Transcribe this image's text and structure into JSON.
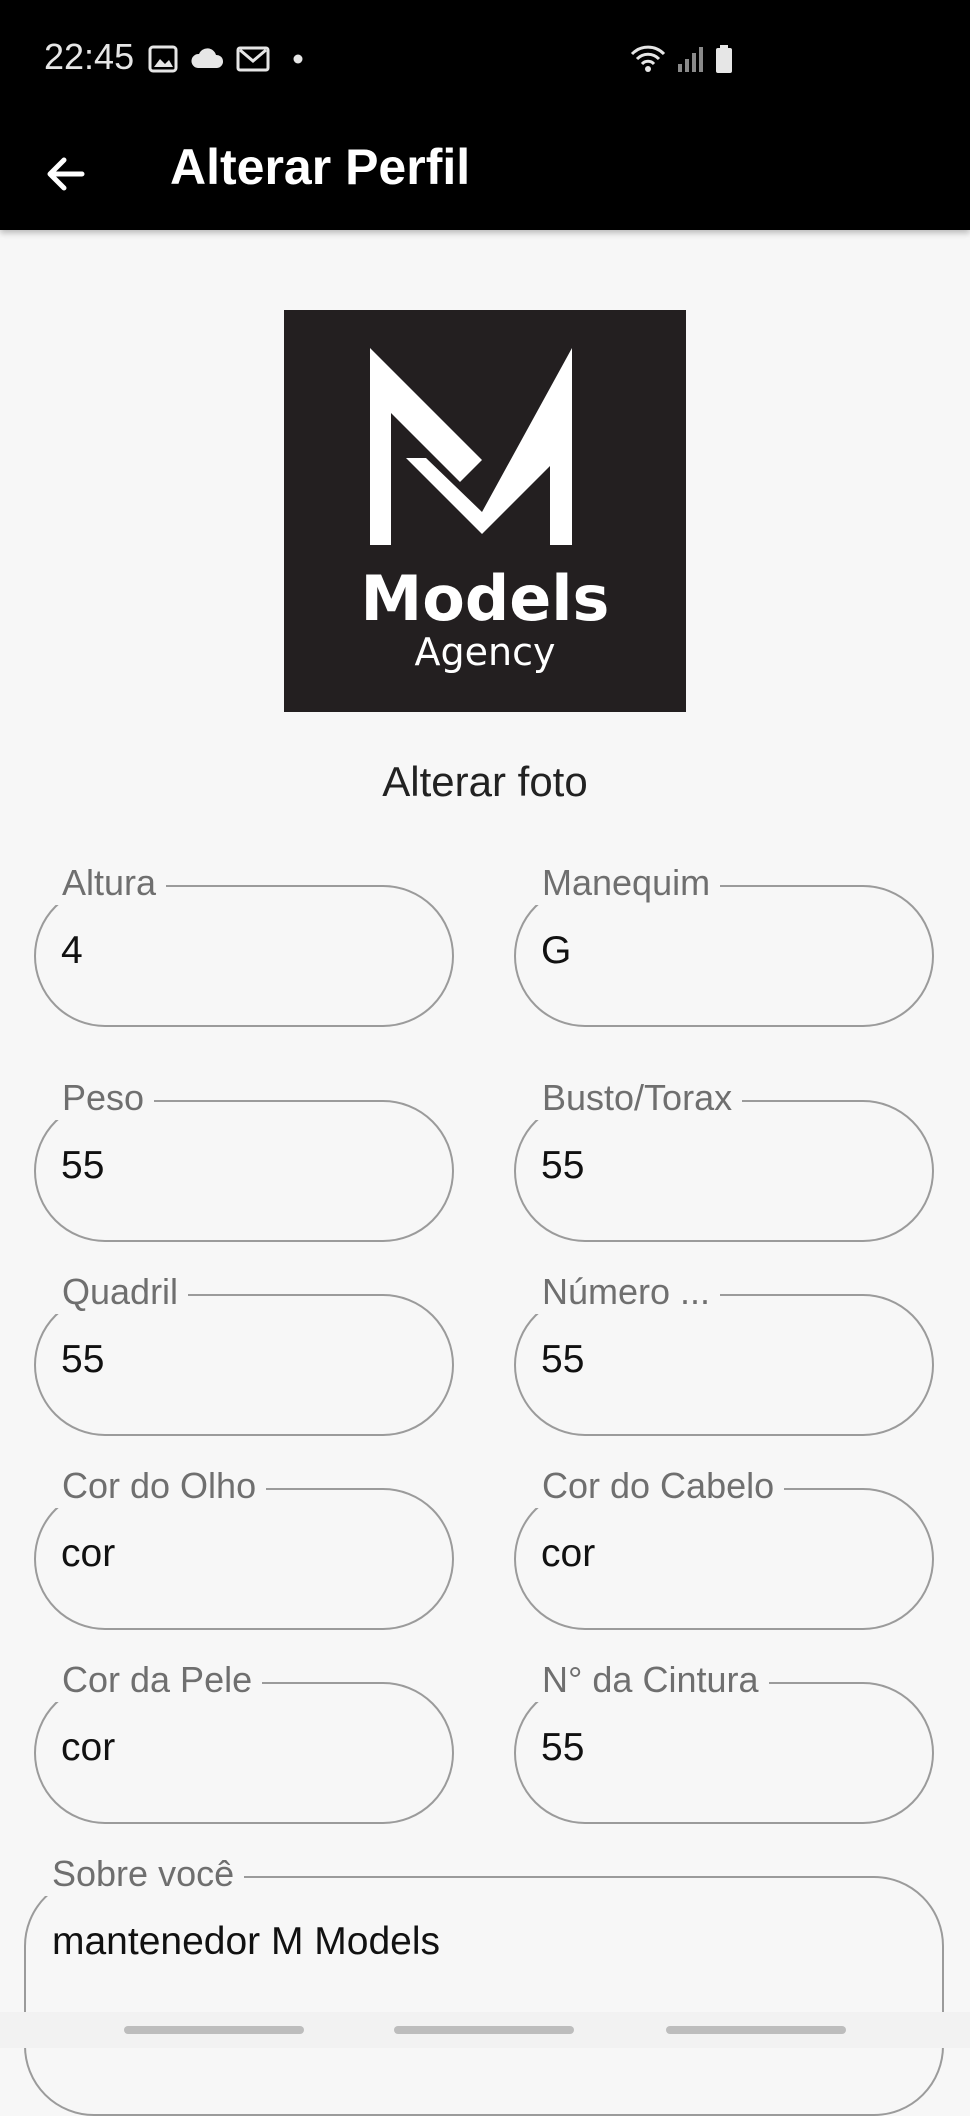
{
  "status_bar": {
    "time": "22:45",
    "icons": [
      "image-icon",
      "cloud-icon",
      "gmail-icon",
      "dot-icon",
      "wifi-icon",
      "signal-icon",
      "battery-icon"
    ]
  },
  "app_bar": {
    "title": "Alterar Perfil",
    "back_icon": "arrow-left-icon"
  },
  "logo": {
    "brand_line1": "Models",
    "brand_line2": "Agency"
  },
  "change_photo_label": "Alterar foto",
  "fields": [
    {
      "label": "Altura",
      "value": "4"
    },
    {
      "label": "Manequim",
      "value": "G"
    },
    {
      "label": "Peso",
      "value": "55"
    },
    {
      "label": "Busto/Torax",
      "value": "55"
    },
    {
      "label": "Quadril",
      "value": "55"
    },
    {
      "label": "Número ...",
      "value": "55"
    },
    {
      "label": "Cor do Olho",
      "value": "cor"
    },
    {
      "label": "Cor do Cabelo",
      "value": "cor"
    },
    {
      "label": "Cor da Pele",
      "value": "cor"
    },
    {
      "label": "N° da Cintura",
      "value": "55"
    }
  ],
  "about": {
    "label": "Sobre você",
    "value": "mantenedor M Models"
  },
  "colors": {
    "bar_background": "#000000",
    "page_background": "#f7f7f7",
    "outline": "#9b9b9b",
    "logo_background": "#231f20"
  }
}
